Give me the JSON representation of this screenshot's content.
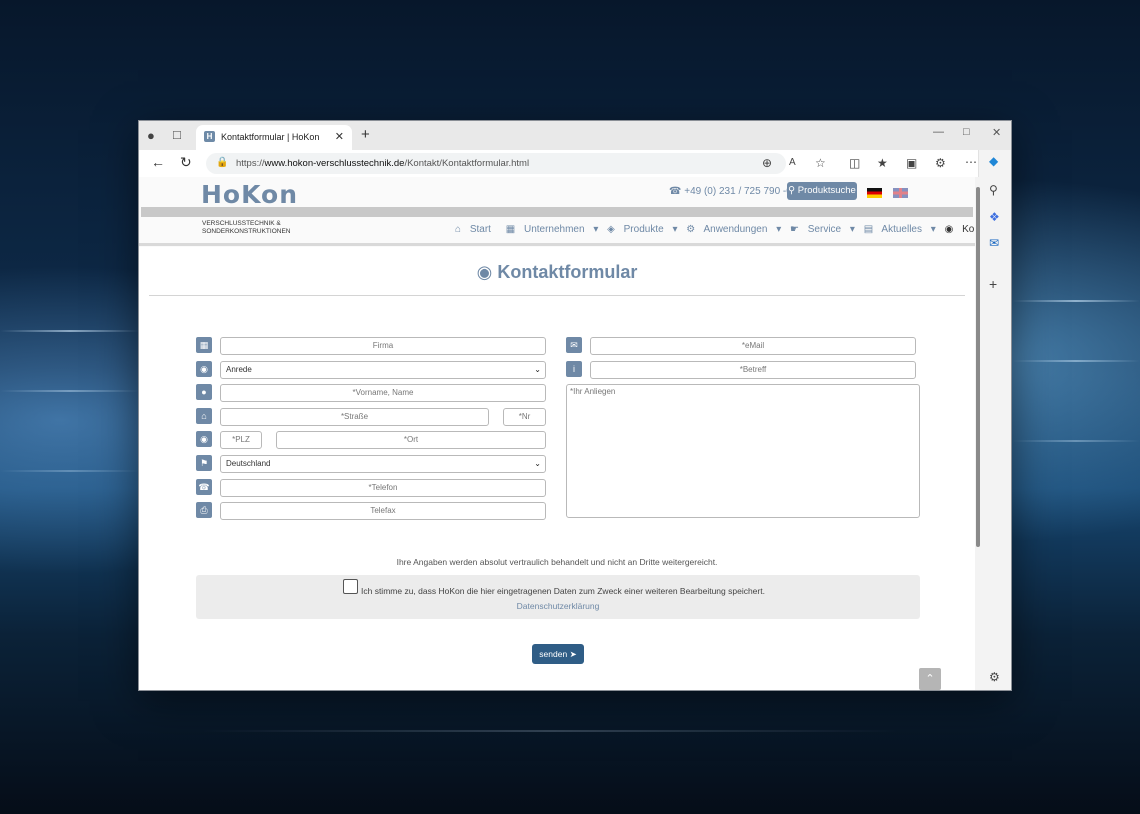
{
  "browser": {
    "tab_title": "Kontaktformular | HoKon",
    "favicon_letter": "H",
    "url_prefix": "https://",
    "url_domain": "www.hokon-verschlusstechnik.de",
    "url_path": "/Kontakt/Kontaktformular.html"
  },
  "header": {
    "logo": "HoKon",
    "logo_sub_line1": "VERSCHLUSSTECHNIK &",
    "logo_sub_line2": "SONDERKONSTRUKTIONEN",
    "phone": "+49 (0) 231 / 725 790 -0",
    "product_search": "Produktsuche"
  },
  "menu": {
    "start": "Start",
    "company": "Unternehmen",
    "products": "Produkte",
    "applications": "Anwendungen",
    "service": "Service",
    "news": "Aktuelles",
    "contact": "Kontakt"
  },
  "page_title": "Kontaktformular",
  "form": {
    "company": "Firma",
    "salutation": "Anrede",
    "name": "*Vorname, Name",
    "street": "*Straße",
    "number": "*Nr",
    "zip": "*PLZ",
    "city": "*Ort",
    "country": "Deutschland",
    "phone": "*Telefon",
    "fax": "Telefax",
    "email": "*eMail",
    "subject": "*Betreff",
    "message": "*Ihr Anliegen"
  },
  "notice": "Ihre Angaben werden absolut vertraulich behandelt und nicht an Dritte weitergereicht.",
  "consent": "Ich stimme zu, dass HoKon die hier eingetragenen Daten zum Zweck einer weiteren Bearbeitung speichert.",
  "privacy_link": "Datenschutzerklärung",
  "send_button": "senden",
  "colors": {
    "accent": "#6f89a6",
    "button": "#2f5d86"
  }
}
